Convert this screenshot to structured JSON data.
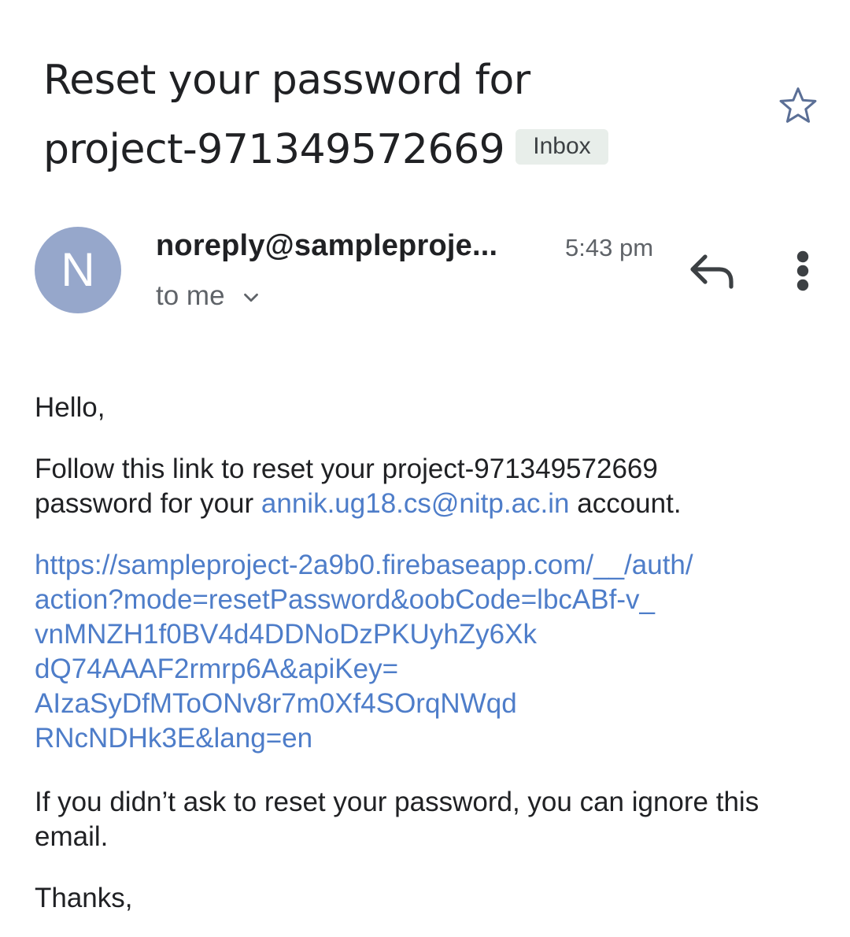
{
  "subject": {
    "line1": "Reset your password for",
    "line2": "project-971349572669",
    "label": "Inbox"
  },
  "icons": {
    "star": "star-outline-icon",
    "reply": "reply-icon",
    "more": "more-vert-icon",
    "chevron": "chevron-down-icon"
  },
  "sender": {
    "avatar_letter": "N",
    "avatar_color": "#96a7cb",
    "name": "noreply@sampleproje...",
    "time": "5:43 pm",
    "recipient": "to me"
  },
  "body": {
    "greeting": "Hello,",
    "intro_before": "Follow this link to reset your project-971349572669 password for your ",
    "email_link": "annik.ug18.cs@nitp.ac.in",
    "intro_after": " account.",
    "url_lines": [
      "https://sampleproject-2a9b0.firebaseapp.com/__/auth/",
      "action?mode=resetPassword&oobCode=lbcABf-v_",
      "vnMNZH1f0BV4d4DDNoDzPKUyhZy6Xk",
      "dQ74AAAF2rmrp6A&apiKey=",
      "AIzaSyDfMToONv8r7m0Xf4SOrqNWqd",
      "RNcNDHk3E&lang=en"
    ],
    "ignore_note": "If you didn’t ask to reset your password, you can ignore this email.",
    "signoff": "Thanks,"
  },
  "colors": {
    "link": "#4e7dc9",
    "badge_bg": "#e8eeea",
    "secondary_text": "#5f6368"
  }
}
